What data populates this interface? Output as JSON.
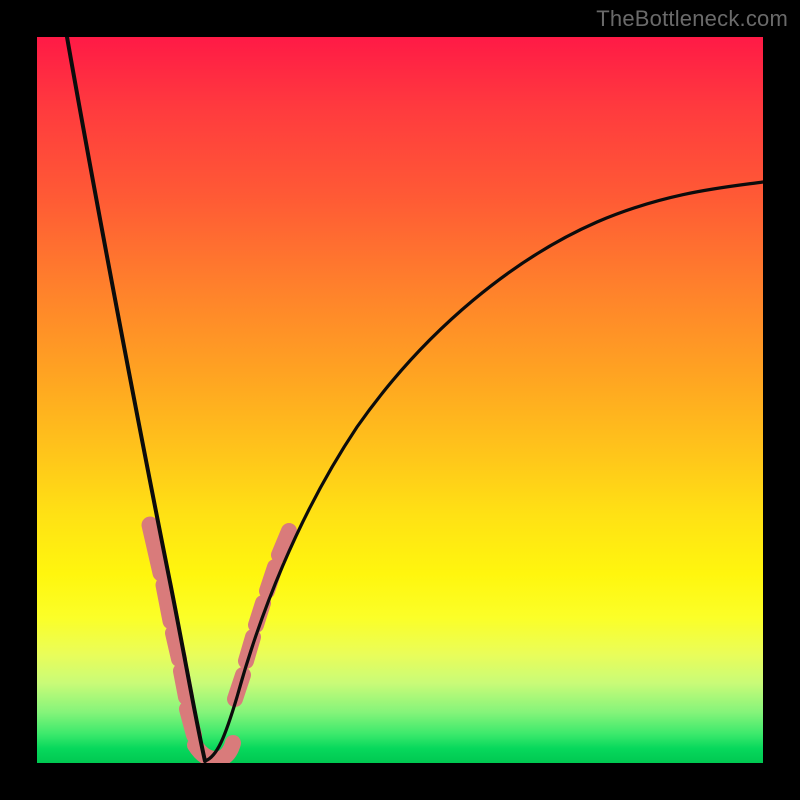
{
  "watermark": "TheBottleneck.com",
  "chart_data": {
    "type": "line",
    "title": "",
    "xlabel": "",
    "ylabel": "",
    "xlim": [
      0,
      100
    ],
    "ylim": [
      0,
      100
    ],
    "grid": false,
    "series": [
      {
        "name": "left-curve",
        "x": [
          4,
          6,
          8,
          10,
          12,
          14,
          16,
          18,
          19,
          20,
          21,
          21.5,
          22,
          23
        ],
        "values": [
          100,
          88,
          75,
          62,
          50,
          40,
          31,
          22,
          17,
          12,
          7,
          4,
          2,
          0
        ]
      },
      {
        "name": "right-curve",
        "x": [
          23,
          24,
          25,
          26,
          28,
          30,
          33,
          37,
          42,
          48,
          55,
          63,
          72,
          82,
          92,
          100
        ],
        "values": [
          0,
          2,
          5,
          8,
          14,
          20,
          27,
          35,
          43,
          51,
          58,
          64,
          69,
          73,
          77,
          80
        ]
      }
    ],
    "annotations": {
      "pink_segments_left": [
        {
          "x_range": [
            15.5,
            17.0
          ],
          "y_range": [
            27,
            34
          ]
        },
        {
          "x_range": [
            17.2,
            18.2
          ],
          "y_range": [
            20,
            26
          ]
        },
        {
          "x_range": [
            18.5,
            19.3
          ],
          "y_range": [
            15,
            19
          ]
        },
        {
          "x_range": [
            19.5,
            20.3
          ],
          "y_range": [
            10,
            14
          ]
        },
        {
          "x_range": [
            20.5,
            21.5
          ],
          "y_range": [
            4,
            9
          ]
        }
      ],
      "pink_segments_right": [
        {
          "x_range": [
            25.5,
            27.0
          ],
          "y_range": [
            9,
            13
          ]
        },
        {
          "x_range": [
            27.5,
            29.0
          ],
          "y_range": [
            15,
            19
          ]
        },
        {
          "x_range": [
            29.5,
            30.5
          ],
          "y_range": [
            20,
            23
          ]
        },
        {
          "x_range": [
            31.0,
            32.5
          ],
          "y_range": [
            24,
            28
          ]
        },
        {
          "x_range": [
            33.0,
            34.5
          ],
          "y_range": [
            29,
            32
          ]
        }
      ],
      "pink_bottom_hook": {
        "x_range": [
          21.5,
          25.0
        ],
        "y_range": [
          0,
          3
        ]
      }
    },
    "colors": {
      "curve": "#101010",
      "highlight": "#d97b7b",
      "gradient_top": "#ff1a46",
      "gradient_bottom": "#00c851"
    }
  }
}
